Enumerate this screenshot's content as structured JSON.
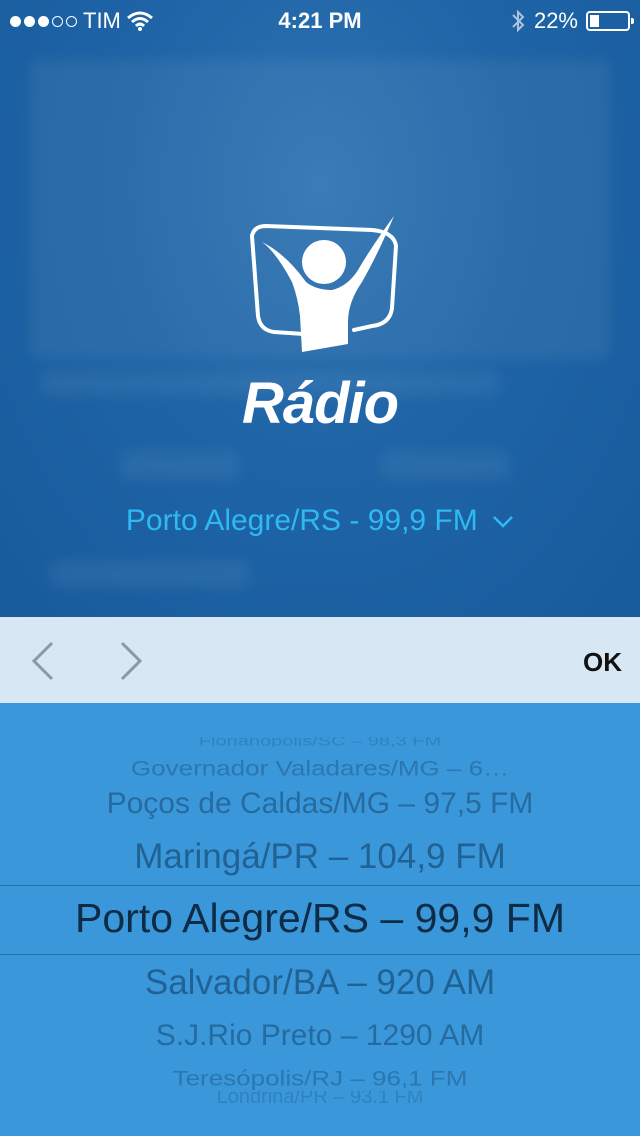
{
  "status_bar": {
    "carrier": "TIM",
    "time": "4:21 PM",
    "battery_percent": "22%",
    "signal_bars": 3,
    "signal_total": 5,
    "battery_level": 0.22
  },
  "header": {
    "title": "Rádio",
    "logo_icon": "person-raised-arms-logo-icon"
  },
  "station_selector": {
    "current": "Porto Alegre/RS - 99,9 FM",
    "icon": "chevron-down-icon"
  },
  "toolbar": {
    "prev_icon": "chevron-left-icon",
    "next_icon": "chevron-right-icon",
    "ok_label": "OK"
  },
  "picker": {
    "items": [
      "Florianópolis/SC – 98,3 FM",
      "Governador Valadares/MG – 6…",
      "Poços de Caldas/MG – 97,5 FM",
      "Maringá/PR – 104,9 FM",
      "Porto Alegre/RS – 99,9 FM",
      "Salvador/BA – 920 AM",
      "S.J.Rio Preto – 1290 AM",
      "Teresópolis/RJ – 96,1 FM",
      "Londrina/PR – 93,1 FM"
    ],
    "selected_index": 4
  },
  "colors": {
    "accent": "#2fb9f3",
    "background": "#1e64a6",
    "toolbar": "#d8e7f4",
    "picker": "#3a97d9"
  }
}
